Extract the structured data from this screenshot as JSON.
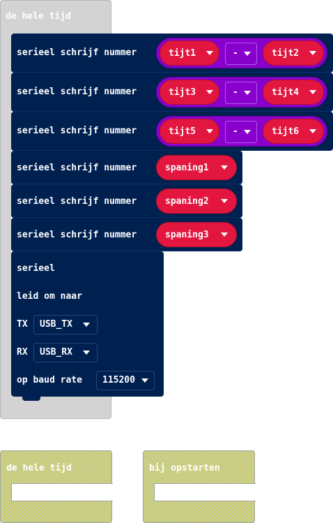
{
  "forever_block": {
    "label": "de hele tijd"
  },
  "statements": [
    {
      "label": "serieel schrijf nummer",
      "left_var": "tijt1",
      "operator": "-",
      "right_var": "tijt2"
    },
    {
      "label": "serieel schrijf nummer",
      "left_var": "tijt3",
      "operator": "-",
      "right_var": "tijt4"
    },
    {
      "label": "serieel schrijf nummer",
      "left_var": "tijt5",
      "operator": "-",
      "right_var": "tijt6"
    },
    {
      "label": "serieel schrijf nummer",
      "var": "spaning1"
    },
    {
      "label": "serieel schrijf nummer",
      "var": "spaning2"
    },
    {
      "label": "serieel schrijf nummer",
      "var": "spaning3"
    }
  ],
  "redirect_block": {
    "line1": "serieel",
    "line2": "leid om naar",
    "tx_label": "TX",
    "tx_value": "USB_TX",
    "rx_label": "RX",
    "rx_value": "USB_RX",
    "baud_label": "op baud rate",
    "baud_value": "115200"
  },
  "ghost_blocks": [
    {
      "label": "de hele tijd"
    },
    {
      "label": "bij opstarten"
    }
  ],
  "colors": {
    "basic_gray": "#d3d3d3",
    "serial_navy": "#002050",
    "variable_red": "#e2163f",
    "math_purple": "#8800cc",
    "ghost_yellow": "#d8cf73"
  }
}
